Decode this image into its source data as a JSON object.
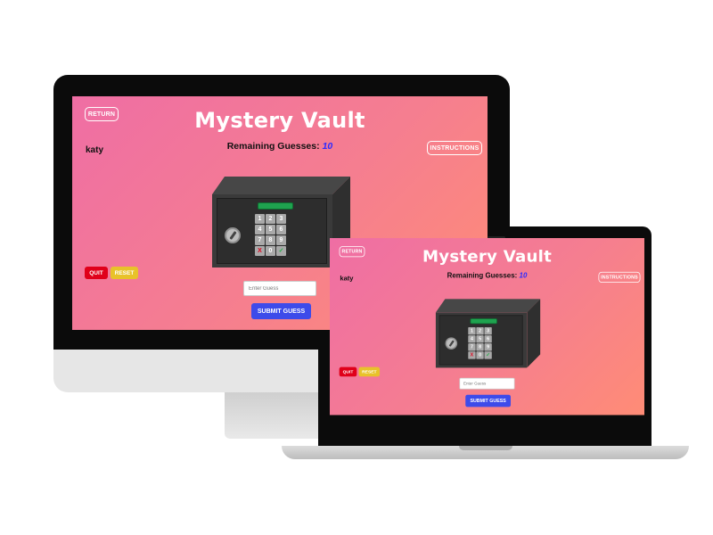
{
  "app": {
    "return_label": "RETURN",
    "title": "Mystery Vault",
    "remaining_label": "Remaining Guesses:",
    "remaining_count": "10",
    "username": "katy",
    "instructions_label": "INSTRUCTIONS",
    "quit_label": "QUIT",
    "reset_label": "RESET",
    "guess_placeholder": "Enter Guess",
    "submit_label": "SUBMIT GUESS",
    "keypad": [
      "1",
      "2",
      "3",
      "4",
      "5",
      "6",
      "7",
      "8",
      "9",
      "X",
      "0",
      "✓"
    ]
  },
  "colors": {
    "gradient_start": "#ef6ea4",
    "gradient_end": "#ff8c76",
    "quit": "#e0001a",
    "reset": "#e8c22a",
    "submit": "#3d4bea",
    "remaining_count": "#2b2bff",
    "lcd": "#1fa34f"
  }
}
